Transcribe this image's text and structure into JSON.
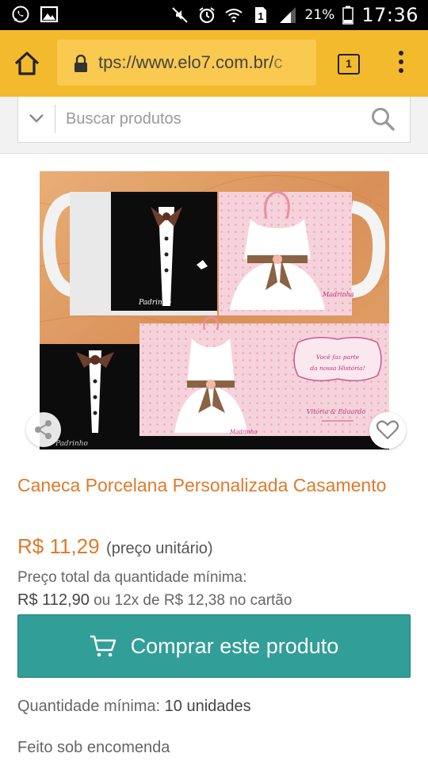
{
  "status_bar": {
    "left_icons": [
      "whatsapp-icon",
      "image-icon"
    ],
    "right_icons": [
      "mute-icon",
      "alarm-icon",
      "wifi-icon",
      "sim-icon",
      "signal-icon",
      "battery-icon"
    ],
    "sim_label": "1",
    "battery": "21%",
    "time": "17:36"
  },
  "browser": {
    "url_prefix": "tps://www.elo7.com.br/",
    "url_fade": "c",
    "tabs_count": "1",
    "colors": {
      "toolbar": "#f4ba2d",
      "url_box": "#fac94f"
    }
  },
  "search": {
    "placeholder": "Buscar produtos"
  },
  "product": {
    "image_texts": {
      "mug1_name": "Padrinho",
      "mug2_name": "Madrinha",
      "bottom_left_name": "Padrinho",
      "bottom_center_name": "Madrinha",
      "card_line1": "Você faz parte",
      "card_line2": "da nossa História!",
      "card_names": "Vitória & Eduardo"
    },
    "title": "Caneca Porcelana Personalizada Casamento",
    "price": "R$ 11,29",
    "price_unit": "(preço unitário)",
    "min_total_label": "Preço total da quantidade mínima:",
    "min_total_value": "R$ 112,90",
    "installments": "ou 12x de R$ 12,38 no cartão",
    "buy_label": "Comprar este produto",
    "min_qty_label": "Quantidade mínima:",
    "min_qty_value": "10 unidades",
    "made_to_order": "Feito sob encomenda",
    "colors": {
      "accent": "#e07a2c",
      "buy_button": "#319e97"
    }
  }
}
